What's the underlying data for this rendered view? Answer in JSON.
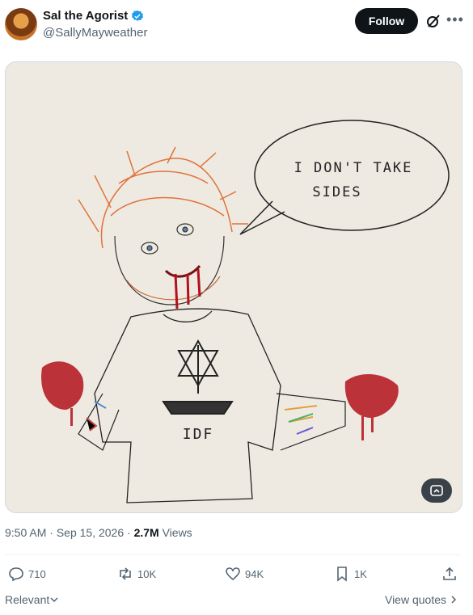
{
  "user": {
    "display_name": "Sal the Agorist",
    "handle": "@SallyMayweather"
  },
  "follow_label": "Follow",
  "image": {
    "speech_bubble": [
      "I DON'T TAKE",
      "SIDES"
    ],
    "shirt_text": "IDF"
  },
  "meta": {
    "time": "9:50 AM",
    "date": "Sep 15, 2026",
    "views_count": "2.7M",
    "views_label": "Views"
  },
  "actions": {
    "replies": "710",
    "reposts": "10K",
    "likes": "94K",
    "bookmarks": "1K"
  },
  "sort_label": "Relevant",
  "view_quotes_label": "View quotes",
  "colors": {
    "verified": "#1d9bf0",
    "hair": "#e0733a",
    "blood": "#b3121b"
  }
}
